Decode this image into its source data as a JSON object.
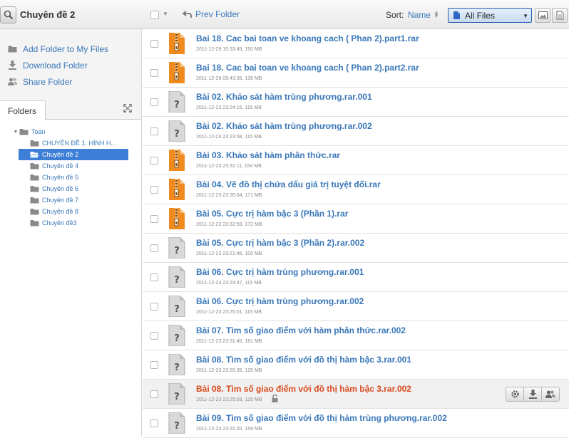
{
  "toolbar": {
    "folder_title": "Chuyên đề 2",
    "prev_folder": "Prev Folder",
    "sort_label": "Sort:",
    "sort_value": "Name",
    "filter_value": "All Files"
  },
  "sidebar": {
    "actions": [
      {
        "label": "Add Folder to My Files",
        "icon": "folder-icon"
      },
      {
        "label": "Download Folder",
        "icon": "download-icon"
      },
      {
        "label": "Share Folder",
        "icon": "share-icon"
      }
    ],
    "folders_tab": "Folders",
    "tree": [
      {
        "label": "Toán",
        "level": 0,
        "selected": false,
        "toggle": "▾"
      },
      {
        "label": "CHUYÊN ĐỀ 1. HÌNH H...",
        "level": 1,
        "selected": false
      },
      {
        "label": "Chuyên đề 2",
        "level": 1,
        "selected": true
      },
      {
        "label": "Chuyên đề 4",
        "level": 1,
        "selected": false
      },
      {
        "label": "Chuyên đề 5",
        "level": 1,
        "selected": false
      },
      {
        "label": "Chuyên đề 6",
        "level": 1,
        "selected": false
      },
      {
        "label": "Chuyên đề 7",
        "level": 1,
        "selected": false
      },
      {
        "label": "Chuyên đề 8",
        "level": 1,
        "selected": false
      },
      {
        "label": "Chuyên đề3",
        "level": 1,
        "selected": false
      }
    ]
  },
  "files": [
    {
      "name": "Bai 18. Cac bai toan ve khoang cach ( Phan 2).part1.rar",
      "meta": "2011-12-29 10:33:49, 150 MB",
      "icon": "archive-icon"
    },
    {
      "name": "Bai 18. Cac bai toan ve khoang cach ( Phan 2).part2.rar",
      "meta": "2011-12-29 09:43:35, 136 MB",
      "icon": "archive-icon"
    },
    {
      "name": "Bài 02. Khảo sát hàm trùng phương.rar.001",
      "meta": "2011-12-23 23:24:16, 115 MB",
      "icon": "unknown-file-icon"
    },
    {
      "name": "Bài 02. Khảo sát hàm trùng phương.rar.002",
      "meta": "2011-12-23 23:23:58, 115 MB",
      "icon": "unknown-file-icon"
    },
    {
      "name": "Bài 03. Khảo sát hàm phân thức.rar",
      "meta": "2011-12-23 23:31:11, 154 MB",
      "icon": "archive-icon"
    },
    {
      "name": "Bài 04. Vẽ đồ thị chứa dấu giá trị tuyệt đối.rar",
      "meta": "2011-12-23 23:35:04, 171 MB",
      "icon": "archive-icon"
    },
    {
      "name": "Bài 05. Cực trị hàm bậc 3 (Phần 1).rar",
      "meta": "2011-12-23 23:32:59, 172 MB",
      "icon": "archive-icon"
    },
    {
      "name": "Bài 05. Cực trị hàm bậc 3 (Phần 2).rar.002",
      "meta": "2011-12-23 23:21:46, 100 MB",
      "icon": "unknown-file-icon"
    },
    {
      "name": "Bài 06. Cực trị hàm trùng phương.rar.001",
      "meta": "2011-12-23 23:24:47, 115 MB",
      "icon": "unknown-file-icon"
    },
    {
      "name": "Bài 06. Cực trị hàm trùng phương.rar.002",
      "meta": "2011-12-23 23:25:01, 115 MB",
      "icon": "unknown-file-icon"
    },
    {
      "name": "Bài 07. Tìm số giao điểm với hàm phân thức.rar.002",
      "meta": "2011-12-23 23:31:45, 161 MB",
      "icon": "unknown-file-icon"
    },
    {
      "name": "Bài 08. Tìm số giao điểm với đồ thị hàm bậc 3.rar.001",
      "meta": "2011-12-23 23:25:35, 125 MB",
      "icon": "unknown-file-icon"
    },
    {
      "name": "Bài 08. Tìm số giao điểm với đồ thị hàm bậc 3.rar.002",
      "meta": "2011-12-23 23:25:59, 125 MB",
      "icon": "unknown-file-icon",
      "hover": true
    },
    {
      "name": "Bài 09. Tìm số giao điểm với đồ thị hàm trùng phương.rar.002",
      "meta": "2011-12-23 23:31:20, 159 MB",
      "icon": "unknown-file-icon"
    }
  ],
  "colors": {
    "link": "#3a78b9",
    "hover_name": "#d94a1e",
    "archive": "#f08a1c",
    "selected": "#3d7fd6"
  }
}
